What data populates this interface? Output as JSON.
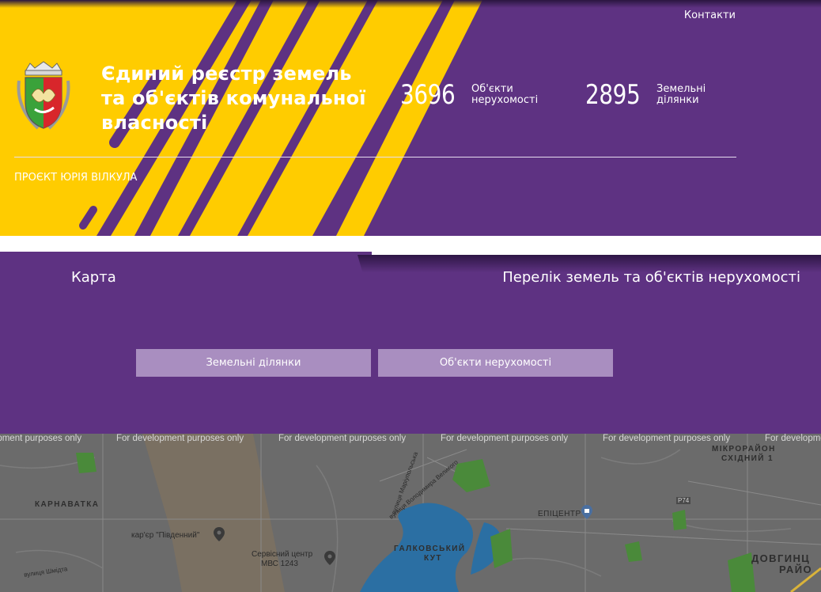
{
  "header": {
    "contacts_label": "Контакти",
    "title": "Єдиний реєстр земель та об'єктів комунальної власності",
    "project_label": "ПРОЄКТ ЮРІЯ ВІЛКУЛА",
    "stats": [
      {
        "value": "3696",
        "label": "Об'єкти нерухомості"
      },
      {
        "value": "2895",
        "label": "Земельні ділянки"
      }
    ]
  },
  "tabs": {
    "map_label": "Карта",
    "list_label": "Перелік земель та об'єктів нерухомості"
  },
  "filters": {
    "land_label": "Земельні ділянки",
    "objects_label": "Об'єкти нерухомості"
  },
  "map": {
    "watermark": "For development purposes only",
    "labels": {
      "karnavatka": "КАРНАВАТКА",
      "mikroraion": "МІКРОРАЙОН",
      "skhidnii": "СХІДНИЙ 1",
      "halkivskyi": "ГАЛКОВСЬКИЙ",
      "kut": "КУТ",
      "dovhyntsi": "ДОВГИНЦ",
      "raion": "РАЙО",
      "kariier": "кар'єр \"Південний\"",
      "servis_line1": "Сервісний центр",
      "servis_line2": "МВС 1243",
      "epicentr": "ЕПІЦЕНТР",
      "road_code": "P74",
      "street_shmidta": "вулиця Шмідта",
      "street_mariupolska": "вулиця Маріупольська",
      "street_velykoho": "вулиця Володимира Великого"
    },
    "colors": {
      "land": "#6b6b6b",
      "water": "#2b6fa3",
      "park": "#4a8a3a",
      "road": "#8a8a8a"
    }
  },
  "theme": {
    "purple": "#5e3282",
    "yellow": "#ffcc00",
    "button": "#a98ec0"
  }
}
